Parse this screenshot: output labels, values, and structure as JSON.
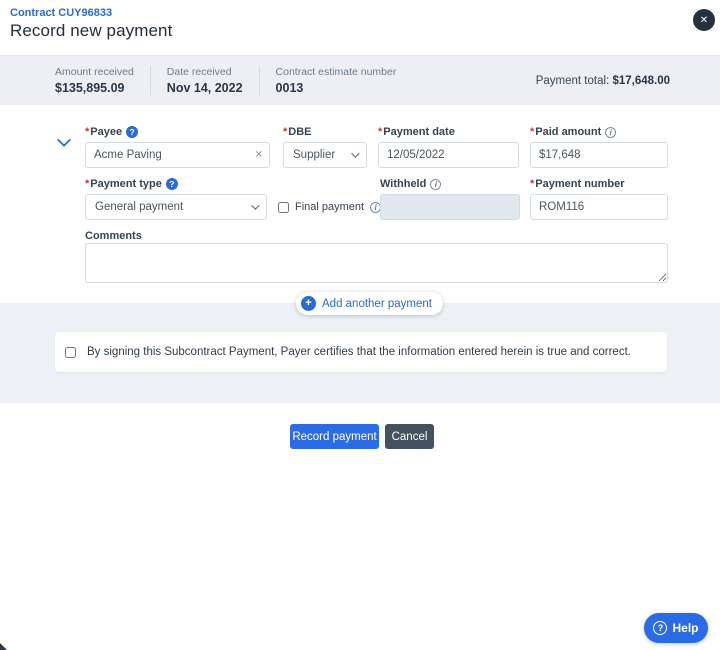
{
  "header": {
    "contract_link": "Contract CUY96833",
    "title": "Record new payment"
  },
  "summary": {
    "stats": [
      {
        "label": "Amount received",
        "value": "$135,895.09"
      },
      {
        "label": "Date received",
        "value": "Nov 14, 2022"
      },
      {
        "label": "Contract estimate number",
        "value": "0013"
      }
    ],
    "payment_total_label": "Payment total:",
    "payment_total_value": "$17,648.00"
  },
  "form": {
    "required_mark": "*",
    "payee": {
      "label": "Payee",
      "value": "Acme Paving"
    },
    "dbe": {
      "label": "DBE",
      "value": "Supplier"
    },
    "payment_date": {
      "label": "Payment date",
      "value": "12/05/2022"
    },
    "paid_amount": {
      "label": "Paid amount",
      "value": "$17,648"
    },
    "payment_type": {
      "label": "Payment type",
      "value": "General payment"
    },
    "final_payment": {
      "label": "Final payment"
    },
    "withheld": {
      "label": "Withheld",
      "value": ""
    },
    "payment_number": {
      "label": "Payment number",
      "value": "ROM116"
    },
    "comments_label": "Comments",
    "comments_value": ""
  },
  "certification": {
    "text": "By signing this Subcontract Payment, Payer certifies that the information entered herein is true and correct."
  },
  "actions": {
    "add_another_label": "Add another payment",
    "record_label": "Record payment",
    "cancel_label": "Cancel",
    "help_label": "Help"
  },
  "icons": {
    "question_glyph": "?",
    "info_glyph": "i",
    "close_glyph": "✕",
    "plus_glyph": "+",
    "clear_glyph": "✕"
  },
  "colors": {
    "accent_blue": "#2b6ce4",
    "link_blue": "#2a6bd7",
    "cancel_slate": "#43525e",
    "close_navy": "#25323e",
    "required_red": "#c43a31",
    "summary_bg": "#edeff3",
    "section_bg": "#edf1f5"
  }
}
